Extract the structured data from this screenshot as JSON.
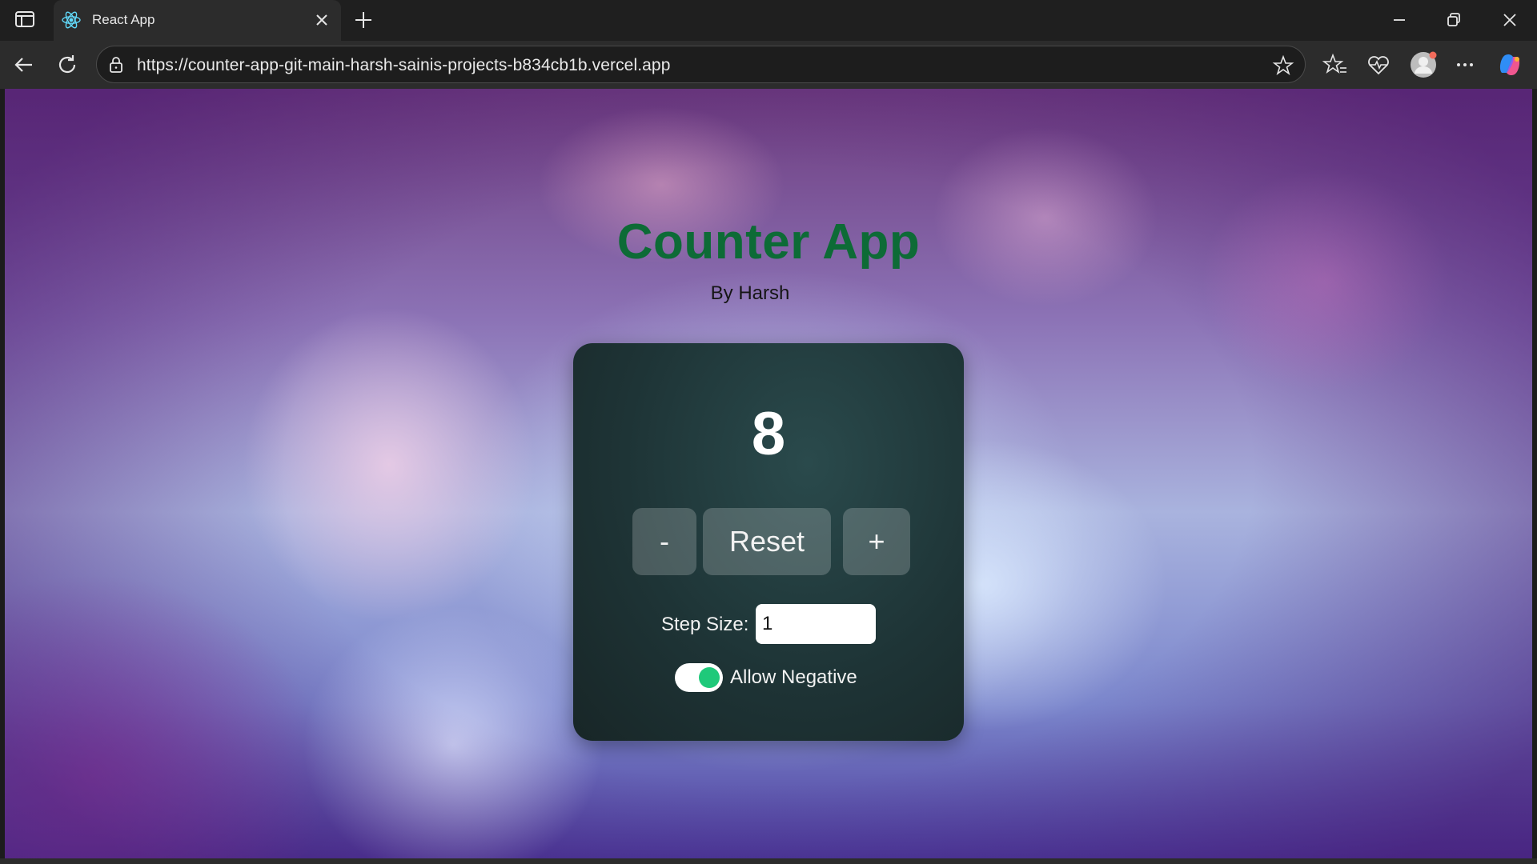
{
  "browser": {
    "tab_title": "React App",
    "url": "https://counter-app-git-main-harsh-sainis-projects-b834cb1b.vercel.app"
  },
  "page": {
    "title": "Counter App",
    "subtitle": "By Harsh"
  },
  "counter": {
    "value": "8",
    "decrement_label": "-",
    "reset_label": "Reset",
    "increment_label": "+",
    "step_label": "Step Size:",
    "step_value": "1",
    "allow_negative_label": "Allow Negative",
    "allow_negative_enabled": true
  },
  "colors": {
    "title": "#0d6b36",
    "toggle_on": "#1fc97a",
    "card_bg": "#1e3436"
  }
}
